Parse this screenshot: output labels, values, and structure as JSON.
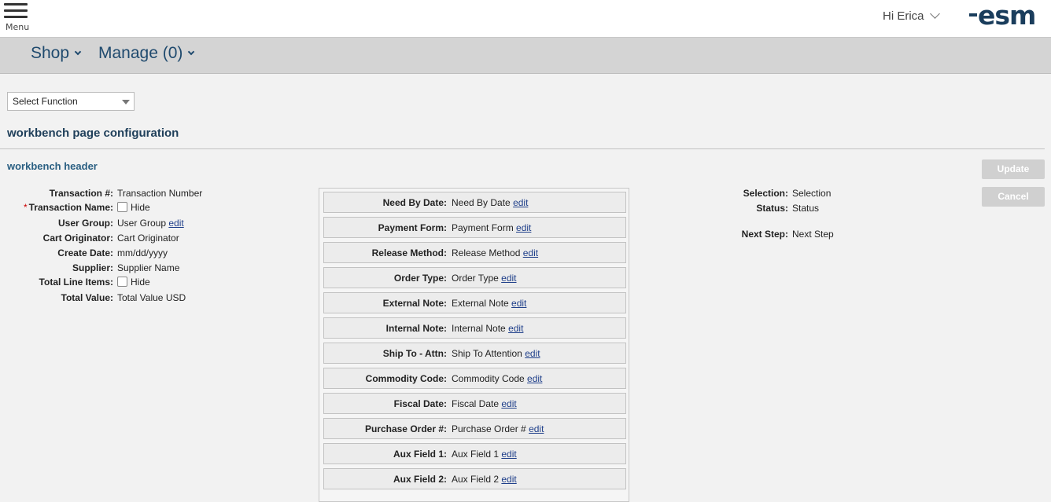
{
  "topbar": {
    "menu_label": "Menu",
    "greeting": "Hi Erica",
    "logo": "esm"
  },
  "nav": [
    {
      "label": "Shop"
    },
    {
      "label": "Manage (0)"
    }
  ],
  "function_select": {
    "value": "Select Function"
  },
  "page_title": "workbench page configuration",
  "section_title": "workbench header",
  "buttons": {
    "update": "Update",
    "cancel": "Cancel"
  },
  "colors": {
    "brand": "#1a3d5c",
    "nav_text": "#1f4a6e",
    "disabled_button": "#d0d0d0",
    "required": "#cc0000"
  },
  "left_fields": [
    {
      "label": "Transaction #:",
      "value": "Transaction Number"
    },
    {
      "label": "Transaction Name:",
      "required": "*",
      "checkbox_label": "Hide"
    },
    {
      "label": "User Group:",
      "value": "User Group",
      "link": "edit"
    },
    {
      "label": "Cart Originator:",
      "value": "Cart Originator"
    },
    {
      "label": "Create Date:",
      "value": "mm/dd/yyyy"
    },
    {
      "label": "Supplier:",
      "value": "Supplier Name"
    },
    {
      "label": "Total Line Items:",
      "checkbox_label": "Hide"
    },
    {
      "label": "Total Value:",
      "value": "Total Value USD"
    }
  ],
  "middle_fields": [
    {
      "label": "Need By Date:",
      "value": "Need By Date",
      "link": "edit"
    },
    {
      "label": "Payment Form:",
      "value": "Payment Form",
      "link": "edit"
    },
    {
      "label": "Release Method:",
      "value": "Release Method",
      "link": "edit"
    },
    {
      "label": "Order Type:",
      "value": "Order Type",
      "link": "edit"
    },
    {
      "label": "External Note:",
      "value": "External Note",
      "link": "edit"
    },
    {
      "label": "Internal Note:",
      "value": "Internal Note",
      "link": "edit"
    },
    {
      "label": "Ship To - Attn:",
      "value": "Ship To Attention",
      "link": "edit"
    },
    {
      "label": "Commodity Code:",
      "value": "Commodity Code",
      "link": "edit"
    },
    {
      "label": "Fiscal Date:",
      "value": "Fiscal Date",
      "link": "edit"
    },
    {
      "label": "Purchase Order #:",
      "value": "Purchase Order #",
      "link": "edit"
    },
    {
      "label": "Aux Field 1:",
      "value": "Aux Field 1",
      "link": "edit"
    },
    {
      "label": "Aux Field 2:",
      "value": "Aux Field 2",
      "link": "edit"
    }
  ],
  "right_fields": [
    {
      "label": "Selection:",
      "value": "Selection"
    },
    {
      "label": "Status:",
      "value": "Status"
    },
    {
      "label": "Next Step:",
      "value": "Next Step"
    }
  ]
}
